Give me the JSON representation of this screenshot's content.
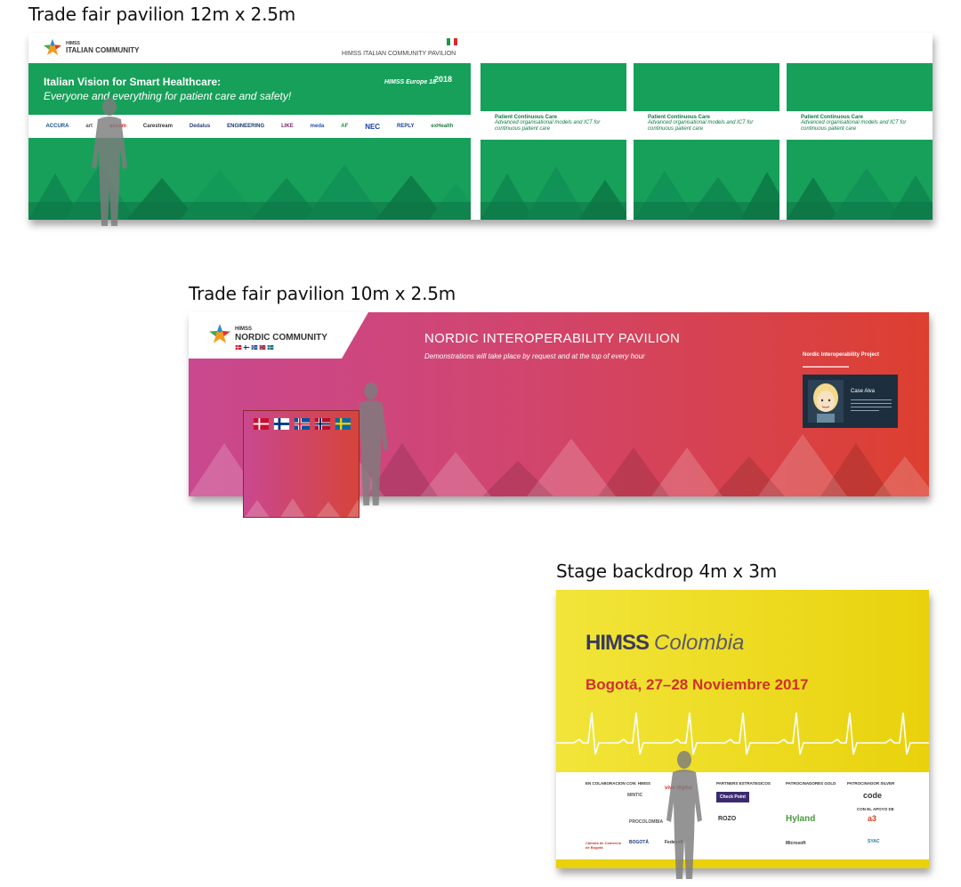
{
  "captions": {
    "italian": "Trade fair pavilion 12m x 2.5m",
    "nordic": "Trade fair pavilion 10m x 2.5m",
    "colombia": "Stage backdrop 4m x 3m"
  },
  "italian": {
    "logo_small": "HIMSS",
    "logo_name": "ITALIAN COMMUNITY",
    "pavilion_title": "HIMSS ITALIAN COMMUNITY PAVILION",
    "headline": "Italian Vision for Smart Healthcare:",
    "subline": "Everyone and everything for patient care and safety!",
    "event_name": "HIMSS Europe 18",
    "event_year": "2018",
    "sponsors": [
      "ACCURA",
      "art",
      "ascom",
      "Carestream",
      "Dedalus",
      "ENGINEERING",
      "LIKE",
      "meda",
      "AF",
      "NEC",
      "REPLY",
      "exHealth"
    ],
    "panels": [
      {
        "title": "Patient Continuous Care",
        "text": "Advanced organisational models and ICT for continuous patient care"
      },
      {
        "title": "Patient Continuous Care",
        "text": "Advanced organisational models and ICT for continuous patient care"
      },
      {
        "title": "Patient Continuous Care",
        "text": "Advanced organisational models and ICT for continuous patient care"
      }
    ],
    "colors": {
      "green": "#17a05a",
      "dark_green": "#0f7a44"
    }
  },
  "nordic": {
    "logo_small": "HIMSS",
    "logo_name": "NORDIC COMMUNITY",
    "title": "NORDIC INTEROPERABILITY PAVILION",
    "subtitle": "Demonstrations will take place by request and at the top of every hour",
    "project_title": "Nordic Interoperability Project",
    "card_name": "Case Alva",
    "flags": [
      "denmark-flag",
      "finland-flag",
      "iceland-flag",
      "norway-flag",
      "sweden-flag"
    ],
    "colors": {
      "magenta": "#c9488f",
      "red": "#dd3f2f"
    }
  },
  "colombia": {
    "logo_himss": "HIMSS",
    "logo_country": "Colombia",
    "date": "Bogotá, 27–28 Noviembre 2017",
    "column_heads": [
      "EN COLABORACION CON: HIMSS",
      "PARTNERS ESTRATEGICOS",
      "PATROCINADORES GOLD",
      "PATROCINADOR SILVER",
      "CON EL APOYO DE"
    ],
    "sponsors": [
      "MINTIC",
      "vive digital",
      "Check Point",
      "code",
      "PROCOLOMBIA",
      "ROZO",
      "Hyland",
      "a3",
      "Cámara de Comercio de Bogotá",
      "BOGOTÁ",
      "Fedesoft",
      "Microsoft",
      "SYAC"
    ],
    "colors": {
      "yellow": "#f0e21a",
      "red": "#d0312d"
    }
  }
}
